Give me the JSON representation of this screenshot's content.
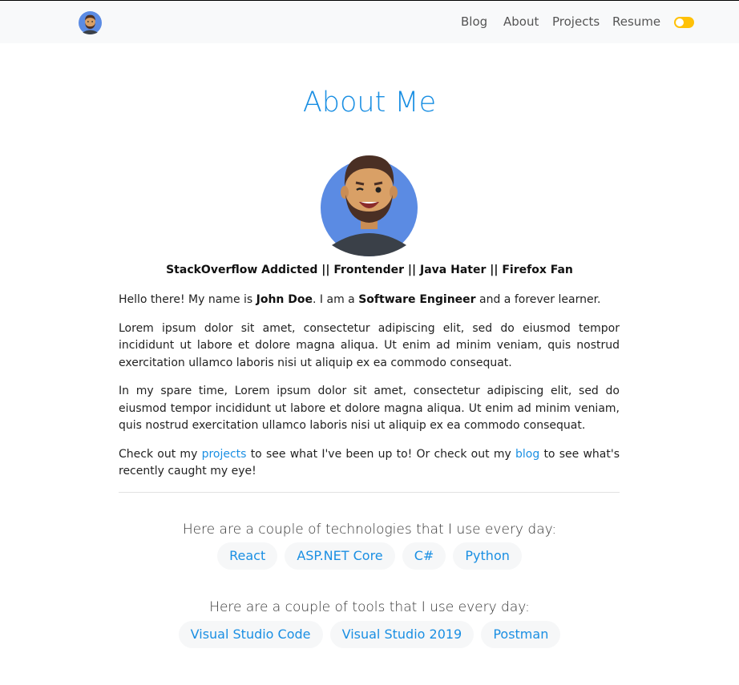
{
  "nav": {
    "items": [
      {
        "label": "Blog"
      },
      {
        "label": "About"
      },
      {
        "label": "Projects"
      },
      {
        "label": "Resume"
      }
    ]
  },
  "colors": {
    "accent": "#1a8fe3",
    "toggle": "#ffc107",
    "avatar_bg": "#5b8be3"
  },
  "page": {
    "title": "About Me",
    "tagline": "StackOverflow Addicted || Frontender || Java Hater || Firefox Fan"
  },
  "intro": {
    "p1_pre": "Hello there! My name is ",
    "name": "John Doe",
    "p1_mid": ". I am a ",
    "role": "Software Engineer",
    "p1_post": " and a forever learner.",
    "p2": "Lorem ipsum dolor sit amet, consectetur adipiscing elit, sed do eiusmod tempor incididunt ut labore et dolore magna aliqua. Ut enim ad minim veniam, quis nostrud exercitation ullamco laboris nisi ut aliquip ex ea commodo consequat.",
    "p3": "In my spare time, Lorem ipsum dolor sit amet, consectetur adipiscing elit, sed do eiusmod tempor incididunt ut labore et dolore magna aliqua. Ut enim ad minim veniam, quis nostrud exercitation ullamco laboris nisi ut aliquip ex ea commodo consequat.",
    "p4_pre": "Check out my ",
    "p4_link1": "projects",
    "p4_mid": " to see what I've been up to! Or check out my ",
    "p4_link2": "blog",
    "p4_post": " to see what's recently caught my eye!"
  },
  "technologies": {
    "heading": "Here are a couple of technologies that I use every day:",
    "items": [
      "React",
      "ASP.NET Core",
      "C#",
      "Python"
    ]
  },
  "tools": {
    "heading": "Here are a couple of tools that I use every day:",
    "items": [
      "Visual Studio Code",
      "Visual Studio 2019",
      "Postman"
    ]
  }
}
